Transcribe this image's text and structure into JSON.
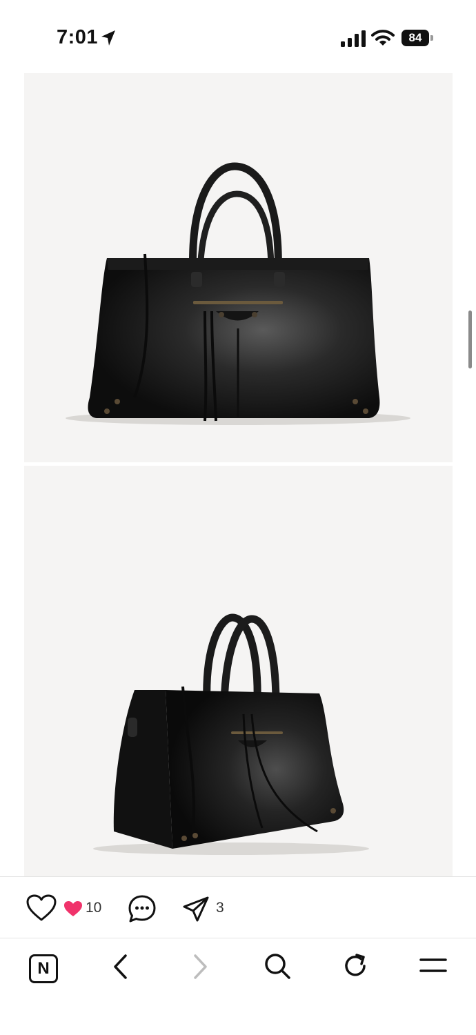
{
  "status_bar": {
    "time": "7:01",
    "battery": "84",
    "icons": [
      "location-arrow-icon",
      "signal-icon",
      "wifi-icon",
      "battery-icon"
    ]
  },
  "content": {
    "images": [
      {
        "description_name": "product-photo-front"
      },
      {
        "description_name": "product-photo-angle"
      }
    ]
  },
  "actions": {
    "like_count": "10",
    "share_count": "3",
    "icons": [
      "heart-outline-icon",
      "heart-filled-icon",
      "comment-icon",
      "send-icon"
    ],
    "accent": "#f0336b"
  },
  "nav": {
    "logo_letter": "N",
    "icons": [
      "back-chevron-icon",
      "forward-chevron-icon",
      "search-icon",
      "refresh-icon",
      "menu-icon"
    ]
  }
}
